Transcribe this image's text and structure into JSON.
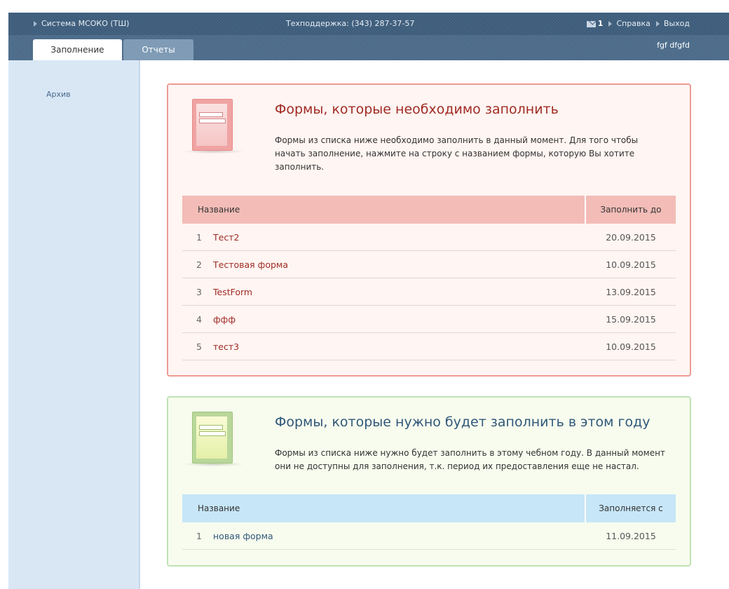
{
  "header": {
    "system_label": "Система МСОКО (ТШ)",
    "support_label": "Техподдержка: (343) 287-37-57",
    "mail_count": "1",
    "help_label": "Справка",
    "logout_label": "Выход"
  },
  "tabs": {
    "active_label": "Заполнение",
    "reports_label": "Отчеты",
    "user_name": "fgf dfgfd"
  },
  "sidebar": {
    "archive_label": "Архив"
  },
  "due_forms": {
    "title": "Формы, которые необходимо заполнить",
    "description": "Формы из списка ниже необходимо заполнить в данный момент. Для того чтобы начать заполнение, нажмите на строку с названием формы, которую Вы хотите заполнить.",
    "col_name": "Название",
    "col_date": "Заполнить до",
    "rows": [
      {
        "num": "1",
        "name": "Тест2",
        "date": "20.09.2015"
      },
      {
        "num": "2",
        "name": "Тестовая форма",
        "date": "10.09.2015"
      },
      {
        "num": "3",
        "name": "TestForm",
        "date": "13.09.2015"
      },
      {
        "num": "4",
        "name": "ффф",
        "date": "15.09.2015"
      },
      {
        "num": "5",
        "name": "тест3",
        "date": "10.09.2015"
      }
    ]
  },
  "upcoming_forms": {
    "title": "Формы, которые нужно будет заполнить в этом году",
    "description": "Формы из списка ниже нужно будет заполнить в этому чебном году. В данный момент они не доступны для заполнения, т.к. период их предоставления еще не настал.",
    "col_name": "Название",
    "col_date": "Заполняется с",
    "rows": [
      {
        "num": "1",
        "name": "новая форма",
        "date": "11.09.2015"
      }
    ]
  },
  "colors": {
    "header_bg": "#3f5f7e",
    "due_accent": "#a12b24",
    "due_border": "#ec9b94",
    "upcoming_accent": "#30577a",
    "upcoming_border": "#bfe3b4"
  },
  "icons": {
    "header_arrow": "triangle-right-icon",
    "mail": "envelope-icon",
    "form": "form-document-icon"
  }
}
